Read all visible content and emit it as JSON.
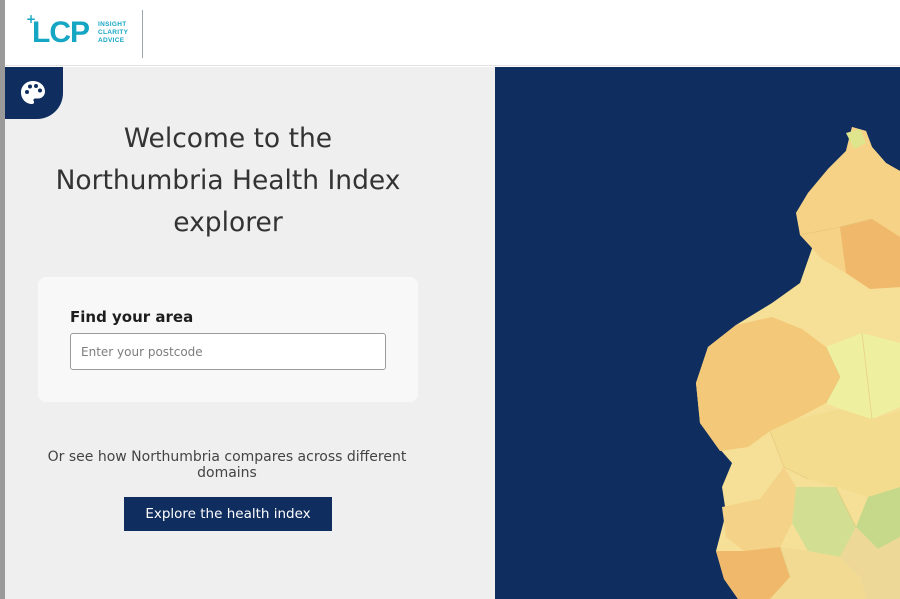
{
  "logo": {
    "mark": "LCP",
    "tagline": [
      "INSIGHT",
      "CLARITY",
      "ADVICE"
    ]
  },
  "welcome": {
    "lines": [
      "Welcome to the",
      "Northumbria Health Index",
      "explorer"
    ]
  },
  "find_area": {
    "title": "Find your area",
    "input_placeholder": "Enter your postcode",
    "input_value": ""
  },
  "compare": {
    "text": "Or see how Northumbria compares across different domains",
    "button_label": "Explore the health index"
  },
  "icons": {
    "theme": "palette-icon"
  },
  "colors": {
    "navy": "#0f2d5e",
    "brand_teal": "#15a6c4",
    "panel_bg": "#efefef",
    "map_orange": "#f2b76a",
    "map_yellow": "#f6df96",
    "map_green": "#c6d98a"
  }
}
